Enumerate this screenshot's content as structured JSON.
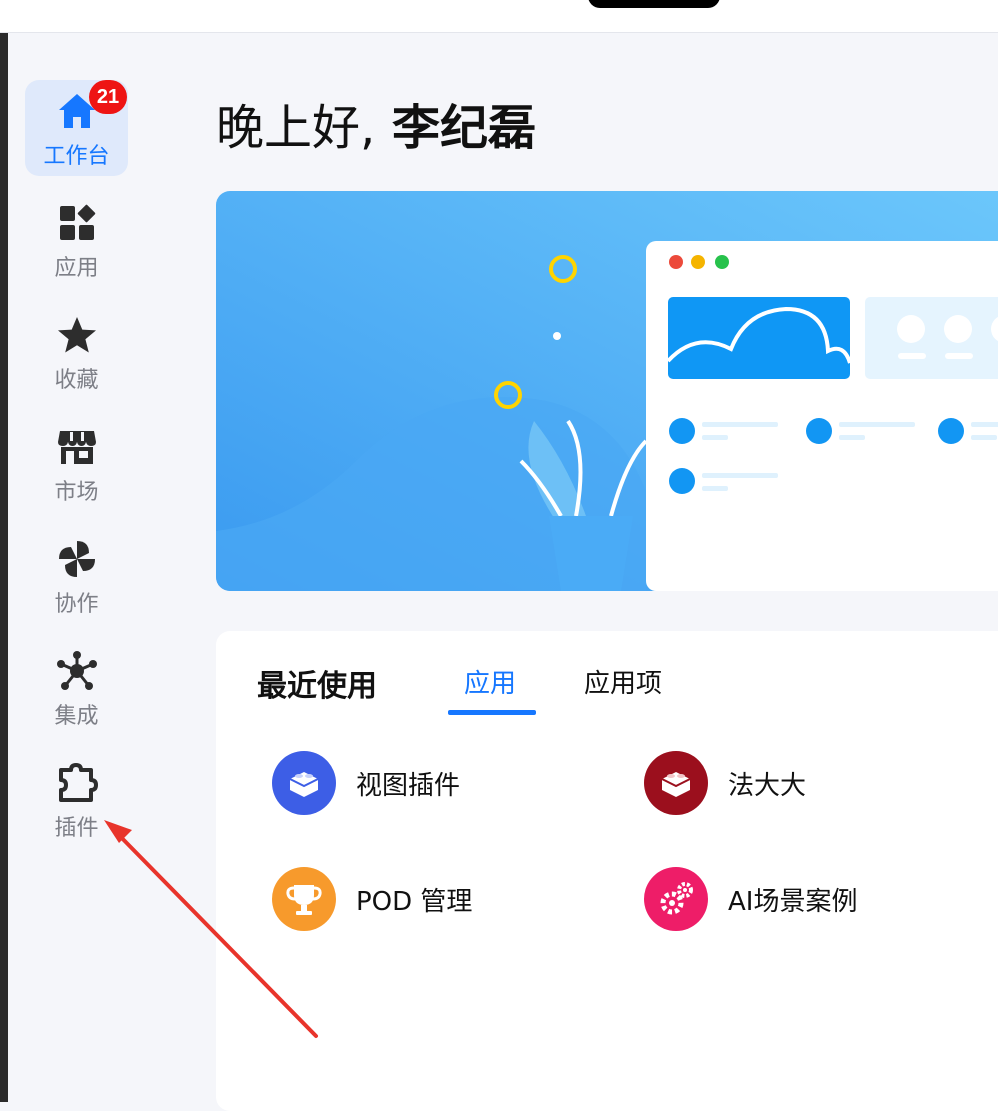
{
  "colors": {
    "accent": "#1677ff",
    "badge": "#ee1414",
    "sidebar_bg": "#f5f6fa",
    "annotation_arrow": "#e8342b"
  },
  "sidebar": {
    "items": [
      {
        "label": "工作台",
        "icon": "home-icon",
        "active": true,
        "badge": "21"
      },
      {
        "label": "应用",
        "icon": "apps-grid-icon"
      },
      {
        "label": "收藏",
        "icon": "star-icon"
      },
      {
        "label": "市场",
        "icon": "store-icon"
      },
      {
        "label": "协作",
        "icon": "pinwheel-icon"
      },
      {
        "label": "集成",
        "icon": "network-icon"
      },
      {
        "label": "插件",
        "icon": "puzzle-icon"
      }
    ]
  },
  "header": {
    "greeting": "晚上好,",
    "user_name": " 李纪磊"
  },
  "recent": {
    "title": "最近使用",
    "tabs": [
      {
        "label": "应用",
        "active": true
      },
      {
        "label": "应用项",
        "active": false
      }
    ],
    "apps": [
      {
        "name": "视图插件",
        "icon": "lego-brick-icon",
        "color": "#3d5ee6"
      },
      {
        "name": "法大大",
        "icon": "lego-brick-icon",
        "color": "#9b0f1d"
      },
      {
        "name": "POD 管理",
        "icon": "trophy-icon",
        "color": "#f79a2c"
      },
      {
        "name": "AI场景案例",
        "icon": "gears-icon",
        "color": "#ee1d68"
      }
    ]
  }
}
